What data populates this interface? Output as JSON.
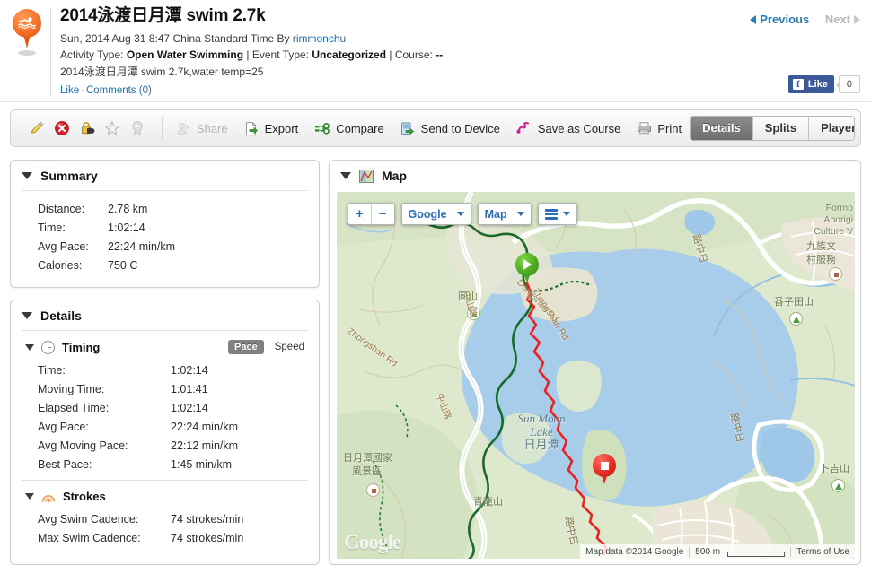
{
  "header": {
    "title": "2014泳渡日月潭 swim 2.7k",
    "date_line_prefix": "Sun, 2014 Aug 31 8:47 China Standard Time By ",
    "author": "rimmonchu",
    "activity_type_label": "Activity Type: ",
    "activity_type_value": "Open Water Swimming",
    "event_type_label": " | Event Type: ",
    "event_type_value": "Uncategorized",
    "course_label": " | Course: ",
    "course_value": "--",
    "description": "2014泳渡日月潭 swim 2.7k,water temp=25",
    "like": "Like",
    "separator": "·",
    "comments": "Comments (0)",
    "previous": "Previous",
    "next": "Next",
    "facebook_like": "Like",
    "facebook_count": "0",
    "facebook_f": "f"
  },
  "toolbar": {
    "icons": [
      {
        "name": "edit-icon",
        "title": "Edit"
      },
      {
        "name": "delete-icon",
        "title": "Delete"
      },
      {
        "name": "privacy-lock-icon",
        "title": "Privacy"
      },
      {
        "name": "favorite-star-icon",
        "title": "Favorite"
      },
      {
        "name": "award-medal-icon",
        "title": "Award"
      }
    ],
    "share": "Share",
    "export": "Export",
    "compare": "Compare",
    "send_to_device": "Send to Device",
    "save_as_course": "Save as Course",
    "print": "Print",
    "tabs": [
      {
        "label": "Details",
        "active": true
      },
      {
        "label": "Splits",
        "active": false
      },
      {
        "label": "Player",
        "active": false
      }
    ]
  },
  "summary": {
    "title": "Summary",
    "rows": [
      {
        "key": "Distance:",
        "value": "2.78 km"
      },
      {
        "key": "Time:",
        "value": "1:02:14"
      },
      {
        "key": "Avg Pace:",
        "value": "22:24 min/km"
      },
      {
        "key": "Calories:",
        "value": "750 C"
      }
    ]
  },
  "details": {
    "title": "Details",
    "timing": {
      "title": "Timing",
      "toggle_pace": "Pace",
      "toggle_speed": "Speed",
      "rows": [
        {
          "key": "Time:",
          "value": "1:02:14"
        },
        {
          "key": "Moving Time:",
          "value": "1:01:41"
        },
        {
          "key": "Elapsed Time:",
          "value": "1:02:14"
        },
        {
          "key": "Avg Pace:",
          "value": "22:24 min/km"
        },
        {
          "key": "Avg Moving Pace:",
          "value": "22:12 min/km"
        },
        {
          "key": "Best Pace:",
          "value": "1:45 min/km"
        }
      ]
    },
    "strokes": {
      "title": "Strokes",
      "rows": [
        {
          "key": "Avg Swim Cadence:",
          "value": "74 strokes/min"
        },
        {
          "key": "Max Swim Cadence:",
          "value": "74 strokes/min"
        }
      ]
    }
  },
  "map": {
    "title": "Map",
    "controls": {
      "zoom_in": "+",
      "zoom_out": "−",
      "provider": "Google",
      "maptype": "Map",
      "layers": "layers"
    },
    "labels": {
      "lake_en_1": "Sun Moon",
      "lake_en_2": "Lake",
      "lake_cn": "日月潭",
      "yuanshan": "圓山",
      "fanzitianshan": "番子田山",
      "qinglongshan": "青龍山",
      "bujishan": "卜吉山",
      "scenic_area_1": "日月潭國家",
      "scenic_area_2": "風景區",
      "formosan_1": "Formo",
      "formosan_2": "Aborigi",
      "formosan_3": "Culture V",
      "formosan_cn_1": "九族文",
      "formosan_cn_2": "村服務",
      "road_zhongshan_cn_a": "中山路",
      "road_zhongshan_cn_b": "中山路",
      "road_zhongshan_en": "Zhongshan Rd",
      "road_zhongshan_rd": "Zhongshan Rd",
      "road_dongshan": "Dongshan Rd",
      "road_cn_small_1": "路中日",
      "road_cn_small_2": "路中日"
    },
    "attribution": {
      "mapdata": "Map data ©2014 Google",
      "scale": "500 m",
      "terms": "Terms of Use",
      "watermark": "Google"
    },
    "markers": {
      "start": "start-marker",
      "end": "end-marker"
    }
  },
  "colors": {
    "route": "#e8231f",
    "link": "#1f6fb5",
    "accent_orange": "#e85a12",
    "water": "#a5cbe8",
    "land": "#d9e6c8",
    "facebook": "#3b5998"
  }
}
